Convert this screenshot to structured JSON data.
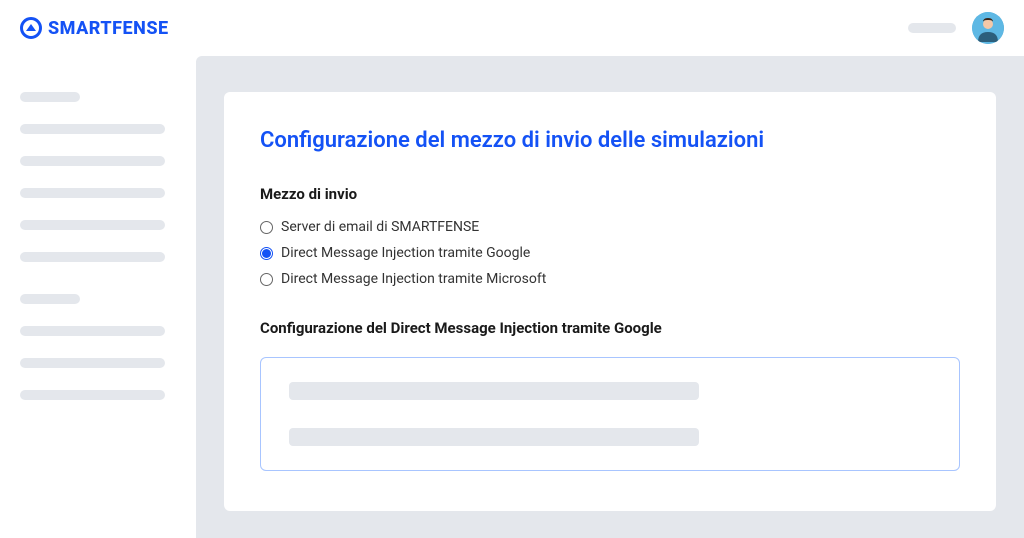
{
  "header": {
    "logo_text": "SMARTFENSE"
  },
  "page": {
    "title": "Configurazione del mezzo di invio delle simulazioni",
    "section_label": "Mezzo di invio",
    "radio_options": [
      {
        "label": "Server di email di SMARTFENSE",
        "selected": false
      },
      {
        "label": "Direct Message Injection tramite Google",
        "selected": true
      },
      {
        "label": "Direct Message Injection tramite Microsoft",
        "selected": false
      }
    ],
    "subsection_label": "Configurazione del Direct Message Injection tramite Google"
  }
}
